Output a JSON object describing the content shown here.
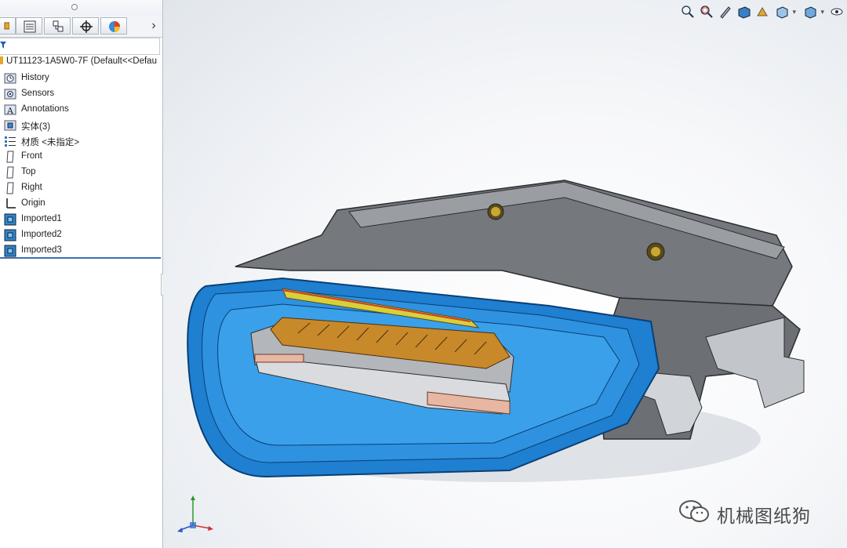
{
  "tree": {
    "root_label": "UT11123-1A5W0-7F  (Default<<Defau",
    "items": [
      {
        "label": "History",
        "icon": "history-folder-icon"
      },
      {
        "label": "Sensors",
        "icon": "sensors-folder-icon"
      },
      {
        "label": "Annotations",
        "icon": "annotations-icon"
      },
      {
        "label": "实体(3)",
        "icon": "solid-bodies-folder-icon"
      },
      {
        "label": "材质 <未指定>",
        "icon": "material-icon"
      },
      {
        "label": "Front",
        "icon": "plane-icon"
      },
      {
        "label": "Top",
        "icon": "plane-icon"
      },
      {
        "label": "Right",
        "icon": "plane-icon"
      },
      {
        "label": "Origin",
        "icon": "origin-icon"
      },
      {
        "label": "Imported1",
        "icon": "imported-body-icon"
      },
      {
        "label": "Imported2",
        "icon": "imported-body-icon"
      },
      {
        "label": "Imported3",
        "icon": "imported-body-icon"
      }
    ]
  },
  "panel_tabs": [
    "feature-manager-tab",
    "property-manager-tab",
    "configuration-manager-tab",
    "dimxpert-manager-tab",
    "display-manager-tab"
  ],
  "heads_up_toolbar": [
    "zoom-to-fit-icon",
    "zoom-to-area-icon",
    "previous-view-icon",
    "section-view-icon",
    "dynamic-annotation-icon",
    "view-orientation-icon",
    "display-style-icon",
    "hide-show-items-icon",
    "edit-appearance-icon",
    "apply-scene-icon",
    "view-settings-icon"
  ],
  "watermark": {
    "text": "机械图纸狗"
  },
  "colors": {
    "accent_blue": "#3d6fb5",
    "connector_blue": "#1f7fd1",
    "shell_gray": "#7a7d82",
    "contact_gold": "#c8892a"
  }
}
